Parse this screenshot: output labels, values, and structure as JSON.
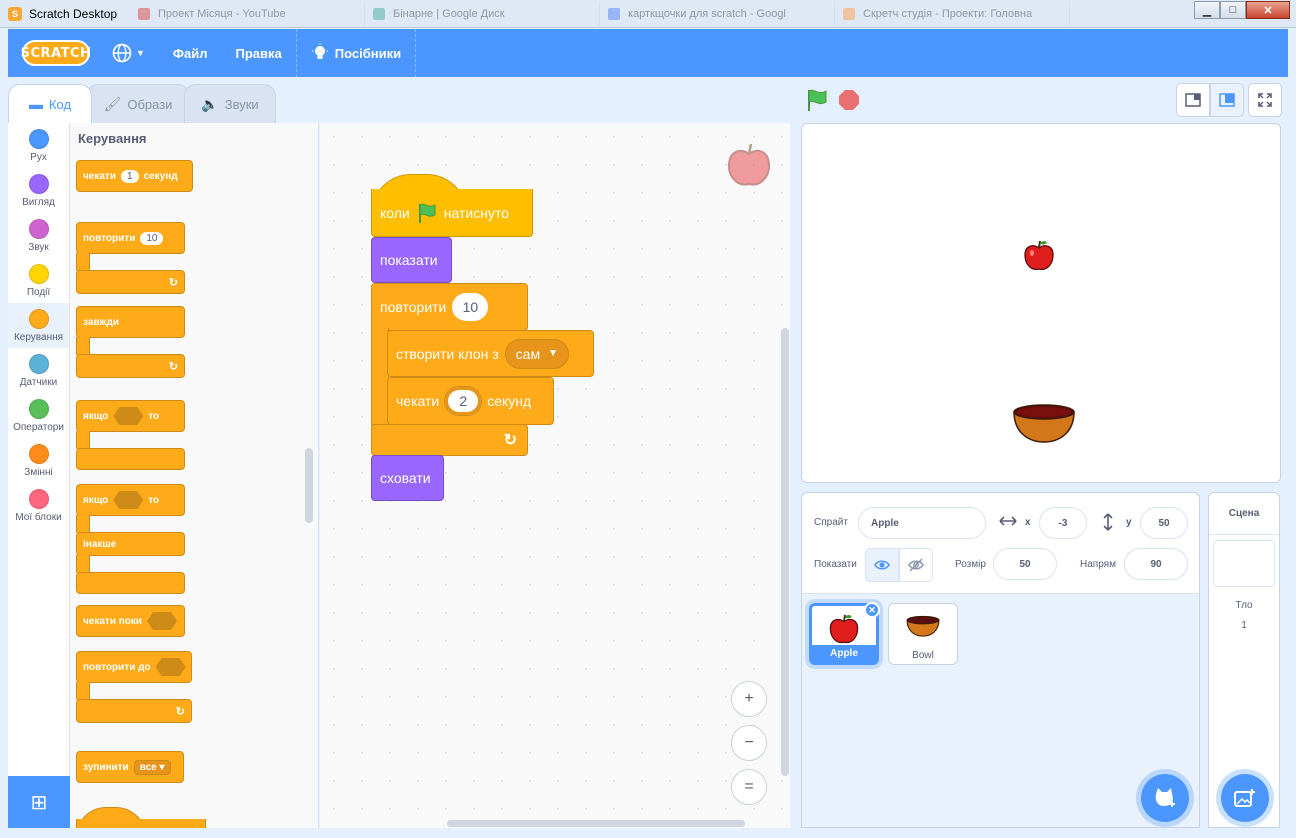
{
  "window": {
    "title": "Scratch Desktop",
    "background_tabs": [
      {
        "label": "Проект Місяця - YouTube",
        "color": "#d33"
      },
      {
        "label": "Бінарне | Google Диск",
        "color": "#3a9"
      },
      {
        "label": "карткщочки для scratch - Googl",
        "color": "#47f"
      },
      {
        "label": "Скретч студія - Проекти: Головна",
        "color": "#f93"
      }
    ],
    "controls": {
      "minimize": "▁",
      "maximize": "□",
      "close": "✕"
    }
  },
  "menubar": {
    "logo": "SCRATCH",
    "language_icon": "globe-icon",
    "file": "Файл",
    "edit": "Правка",
    "tutorials": "Посібники",
    "color": "#4c97ff"
  },
  "tabs": {
    "code": "Код",
    "costumes": "Образи",
    "sounds": "Звуки"
  },
  "categories": [
    {
      "label": "Рух",
      "color": "#4c97ff"
    },
    {
      "label": "Вигляд",
      "color": "#9966ff"
    },
    {
      "label": "Звук",
      "color": "#cf63cf"
    },
    {
      "label": "Події",
      "color": "#ffd500"
    },
    {
      "label": "Керування",
      "color": "#ffab19"
    },
    {
      "label": "Датчики",
      "color": "#5cb1d6"
    },
    {
      "label": "Оператори",
      "color": "#59c059"
    },
    {
      "label": "Змінні",
      "color": "#ff8c1a"
    },
    {
      "label": "Мої блоки",
      "color": "#ff6680"
    }
  ],
  "palette": {
    "title": "Керування",
    "wait_pre": "чекати",
    "wait_val": "1",
    "wait_post": "секунд",
    "repeat_pre": "повторити",
    "repeat_val": "10",
    "forever": "завжди",
    "if_pre": "якщо",
    "if_post": "то",
    "ifelse_pre": "якщо",
    "ifelse_post": "то",
    "else": "інакше",
    "wait_until": "чекати поки",
    "repeat_until": "повторити до",
    "stop_pre": "зупинити",
    "stop_val": "все"
  },
  "script": {
    "hat_pre": "коли",
    "hat_post": "натиснуто",
    "show": "показати",
    "repeat_pre": "повторити",
    "repeat_val": "10",
    "clone_pre": "створити клон з",
    "clone_val": "сам",
    "wait_pre": "чекати",
    "wait_val": "2",
    "wait_post": "секунд",
    "hide": "сховати",
    "zoom_in": "+",
    "zoom_out": "−",
    "zoom_reset": "="
  },
  "sprite_info": {
    "sprite_label": "Спрайт",
    "sprite_name": "Apple",
    "x_label": "x",
    "x": "-3",
    "y_label": "y",
    "y": "50",
    "show_label": "Показати",
    "size_label": "Розмір",
    "size": "50",
    "direction_label": "Напрям",
    "direction": "90"
  },
  "sprites": [
    {
      "name": "Apple",
      "selected": true
    },
    {
      "name": "Bowl",
      "selected": false
    }
  ],
  "stage_pane": {
    "title": "Сцена",
    "backdrops_label": "Тло",
    "backdrops_count": "1"
  }
}
